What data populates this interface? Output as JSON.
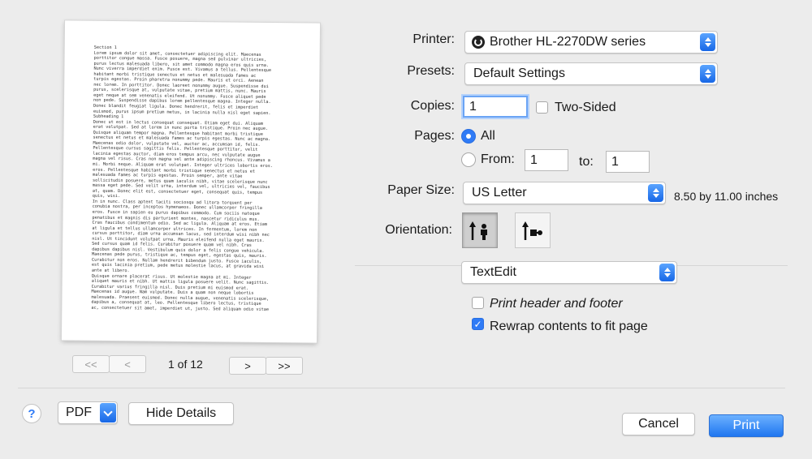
{
  "preview": {
    "lines": [
      "Section 1",
      "Lorem ipsum dolor sit amet, consectetuer adipiscing elit. Maecenas",
      "porttitor congue massa. Fusce posuere, magna sed pulvinar ultricies,",
      "purus lectus malesuada libero, sit amet commodo magna eros quis urna.",
      "Nunc viverra imperdiet enim. Fusce est. Vivamus a tellus. Pellentesque",
      "habitant morbi tristique senectus et netus et malesuada fames ac",
      "turpis egestas. Proin pharetra nonummy pede. Mauris et orci. Aenean",
      "nec lorem. In porttitor. Donec laoreet nonummy augue. Suspendisse dui",
      "purus, scelerisque at, vulputate vitae, pretium mattis, nunc. Mauris",
      "eget neque at sem venenatis eleifend. Ut nonummy. Fusce aliquet pede",
      "non pede. Suspendisse dapibus lorem pellentesque magna. Integer nulla.",
      "Donec blandit feugiat ligula. Donec hendrerit, felis et imperdiet",
      "euismod, purus ipsum pretium metus, in lacinia nulla nisl eget sapien.",
      "Subheading 1",
      "Donec ut est in lectus consequat consequat. Etiam eget dui. Aliquam",
      "erat volutpat. Sed at lorem in nunc porta tristique. Proin nec augue.",
      "Quisque aliquam tempor magna. Pellentesque habitant morbi tristique",
      "senectus et netus et malesuada fames ac turpis egestas. Nunc ac magna.",
      "Maecenas odio dolor, vulputate vel, auctor ac, accumsan id, felis.",
      "Pellentesque cursus sagittis felis. Pellentesque porttitor, velit",
      "lacinia egestas auctor, diam eros tempus arcu, nec vulputate augue",
      "magna vel risus. Cras non magna vel ante adipiscing rhoncus. Vivamus a",
      "mi. Morbi neque. Aliquam erat volutpat. Integer ultrices lobortis eros.",
      "eros. Pellentesque habitant morbi tristique senectus et netus et",
      "malesuada fames ac turpis egestas. Proin semper, ante vitae",
      "sollicitudin posuere, metus quam iaculis nibh, vitae scelerisque nunc",
      "massa eget pede. Sed velit urna, interdum vel, ultricies vel, faucibus",
      "at, quam. Donec elit est, consectetuer eget, consequat quis, tempus",
      "quis, wisi.",
      "In in nunc. Class aptent taciti sociosqu ad litora torquent per",
      "conubia nostra, per inceptos hymenaeos. Donec ullamcorper fringilla",
      "eros. Fusce in sapien eu purus dapibus commodo. Cum sociis natoque",
      "penatibus et magnis dis parturient montes, nascetur ridiculus mus.",
      "Cras faucibus condimentum odio. Sed ac ligula. Aliquam at eros. Etiam",
      "at ligula et tellus ullamcorper ultrices. In fermentum, lorem non",
      "cursus porttitor, diam urna accumsan lacus, sed interdum wisi nibh nec",
      "nisl. Ut tincidunt volutpat urna. Mauris eleifend nulla eget mauris.",
      "Sed cursus quam id felis. Curabitur posuere quam vel nibh. Cras",
      "dapibus dapibus nisl. Vestibulum quis dolor a felis congue vehicula.",
      "Maecenas pede purus, tristique ac, tempus eget, egestas quis, mauris.",
      "Curabitur non eros. Nullam hendrerit bibendum justo. Fusce iaculis,",
      "est quis lacinia pretium, pede metus molestie lacus, at gravida wisi",
      "ante at libero.",
      "Quisque ornare placerat risus. Ut molestie magna at mi. Integer",
      "aliquet mauris et nibh. Ut mattis ligula posuere velit. Nunc sagittis.",
      "Curabitur varius fringilla nisl. Duis pretium mi euismod erat.",
      "Maecenas id augue. Nam vulputate. Duis a quam non neque lobortis",
      "malesuada. Praesent euismod. Donec nulla augue, venenatis scelerisque,",
      "dapibus a, consequat at, leo. Pellentesque libero lectus, tristique",
      "ac, consectetuer sit amet, imperdiet ut, justo. Sed aliquam odio vitae"
    ]
  },
  "pager": {
    "first": "<<",
    "prev": "<",
    "page_text": "1 of 12",
    "next": ">",
    "last": ">>"
  },
  "form": {
    "printer_label": "Printer:",
    "printer_value": "Brother HL-2270DW series",
    "presets_label": "Presets:",
    "presets_value": "Default Settings",
    "copies_label": "Copies:",
    "copies_value": "1",
    "two_sided_label": "Two-Sided",
    "pages_label": "Pages:",
    "pages_all": "All",
    "pages_from": "From:",
    "from_value": "1",
    "to_label": "to:",
    "to_value": "1",
    "paper_size_label": "Paper Size:",
    "paper_size_value": "US Letter",
    "paper_dims": "8.50 by 11.00 inches",
    "orientation_label": "Orientation:",
    "section_value": "TextEdit",
    "header_footer_label": "Print header and footer",
    "rewrap_label": "Rewrap contents to fit page"
  },
  "footer": {
    "help": "?",
    "pdf": "PDF",
    "hide_details": "Hide Details",
    "cancel": "Cancel",
    "print": "Print"
  },
  "colors": {
    "accent": "#2f7bf6",
    "background": "#ececec"
  }
}
